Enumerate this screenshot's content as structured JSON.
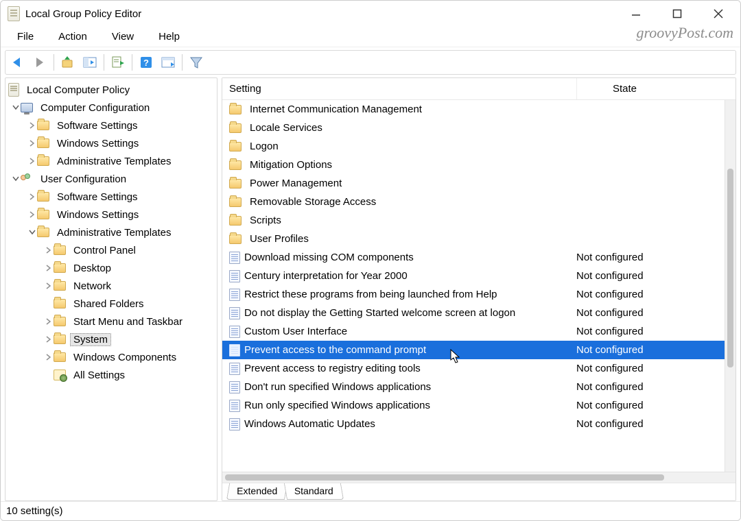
{
  "window": {
    "title": "Local Group Policy Editor"
  },
  "watermark": "groovyPost.com",
  "menubar": [
    "File",
    "Action",
    "View",
    "Help"
  ],
  "columns": {
    "setting": "Setting",
    "state": "State"
  },
  "tree": {
    "root": "Local Computer Policy",
    "computer_config": "Computer Configuration",
    "user_config": "User Configuration",
    "software_settings": "Software Settings",
    "windows_settings": "Windows Settings",
    "admin_templates": "Administrative Templates",
    "control_panel": "Control Panel",
    "desktop": "Desktop",
    "network": "Network",
    "shared_folders": "Shared Folders",
    "start_menu": "Start Menu and Taskbar",
    "system": "System",
    "windows_components": "Windows Components",
    "all_settings": "All Settings"
  },
  "folders": [
    "Internet Communication Management",
    "Locale Services",
    "Logon",
    "Mitigation Options",
    "Power Management",
    "Removable Storage Access",
    "Scripts",
    "User Profiles"
  ],
  "settings": [
    {
      "name": "Download missing COM components",
      "state": "Not configured"
    },
    {
      "name": "Century interpretation for Year 2000",
      "state": "Not configured"
    },
    {
      "name": "Restrict these programs from being launched from Help",
      "state": "Not configured"
    },
    {
      "name": "Do not display the Getting Started welcome screen at logon",
      "state": "Not configured"
    },
    {
      "name": "Custom User Interface",
      "state": "Not configured"
    },
    {
      "name": "Prevent access to the command prompt",
      "state": "Not configured",
      "selected": true
    },
    {
      "name": "Prevent access to registry editing tools",
      "state": "Not configured"
    },
    {
      "name": "Don't run specified Windows applications",
      "state": "Not configured"
    },
    {
      "name": "Run only specified Windows applications",
      "state": "Not configured"
    },
    {
      "name": "Windows Automatic Updates",
      "state": "Not configured"
    }
  ],
  "tabs": {
    "extended": "Extended",
    "standard": "Standard"
  },
  "status": "10 setting(s)"
}
